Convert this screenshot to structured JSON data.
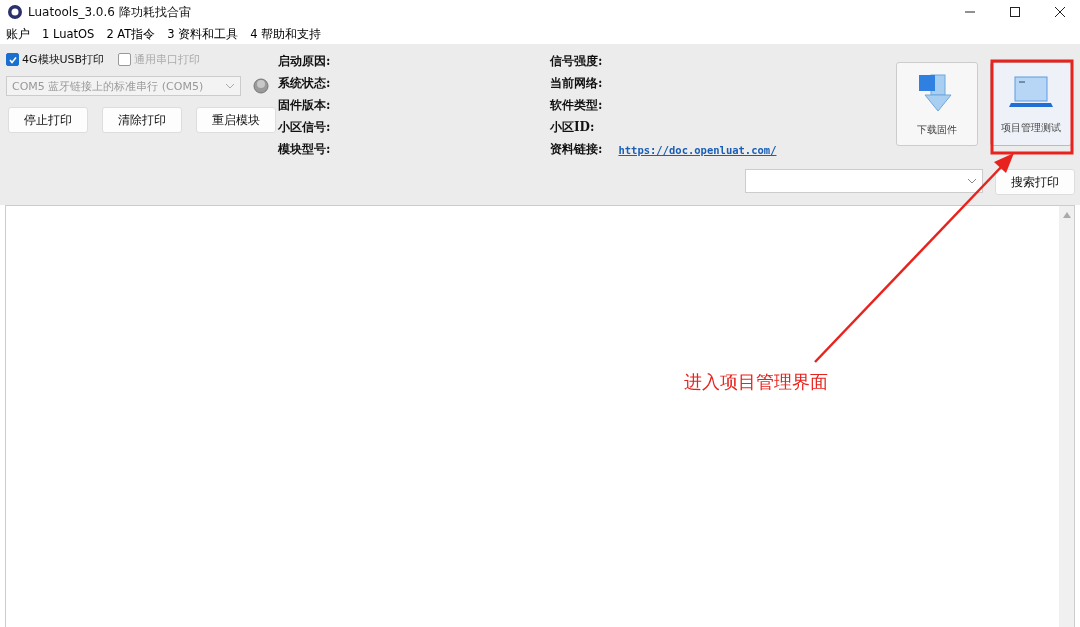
{
  "window": {
    "title": "Luatools_3.0.6 降功耗找合宙"
  },
  "menu": [
    "账户",
    "1 LuatOS",
    "2 AT指令",
    "3 资料和工具",
    "4 帮助和支持"
  ],
  "print_options": [
    {
      "label": "4G模块USB打印",
      "checked": true,
      "disabled": false
    },
    {
      "label": "通用串口打印",
      "checked": false,
      "disabled": true
    }
  ],
  "port_select": {
    "value": "COM5 蓝牙链接上的标准串行 (COM5)",
    "disabled": true
  },
  "buttons": [
    "停止打印",
    "清除打印",
    "重启模块"
  ],
  "info_left": [
    "启动原因:",
    "系统状态:",
    "固件版本:",
    "小区信号:",
    "模块型号:"
  ],
  "info_right": [
    "信号强度:",
    "当前网络:",
    "软件类型:",
    "小区ID:",
    "资料链接:"
  ],
  "link": "https://doc.openluat.com/",
  "tool_buttons": [
    {
      "kind": "download",
      "label": "下载固件",
      "highlighted": false
    },
    {
      "kind": "project",
      "label": "项目管理测试",
      "highlighted": true
    }
  ],
  "search_button": "搜索打印",
  "annotation": "进入项目管理界面"
}
